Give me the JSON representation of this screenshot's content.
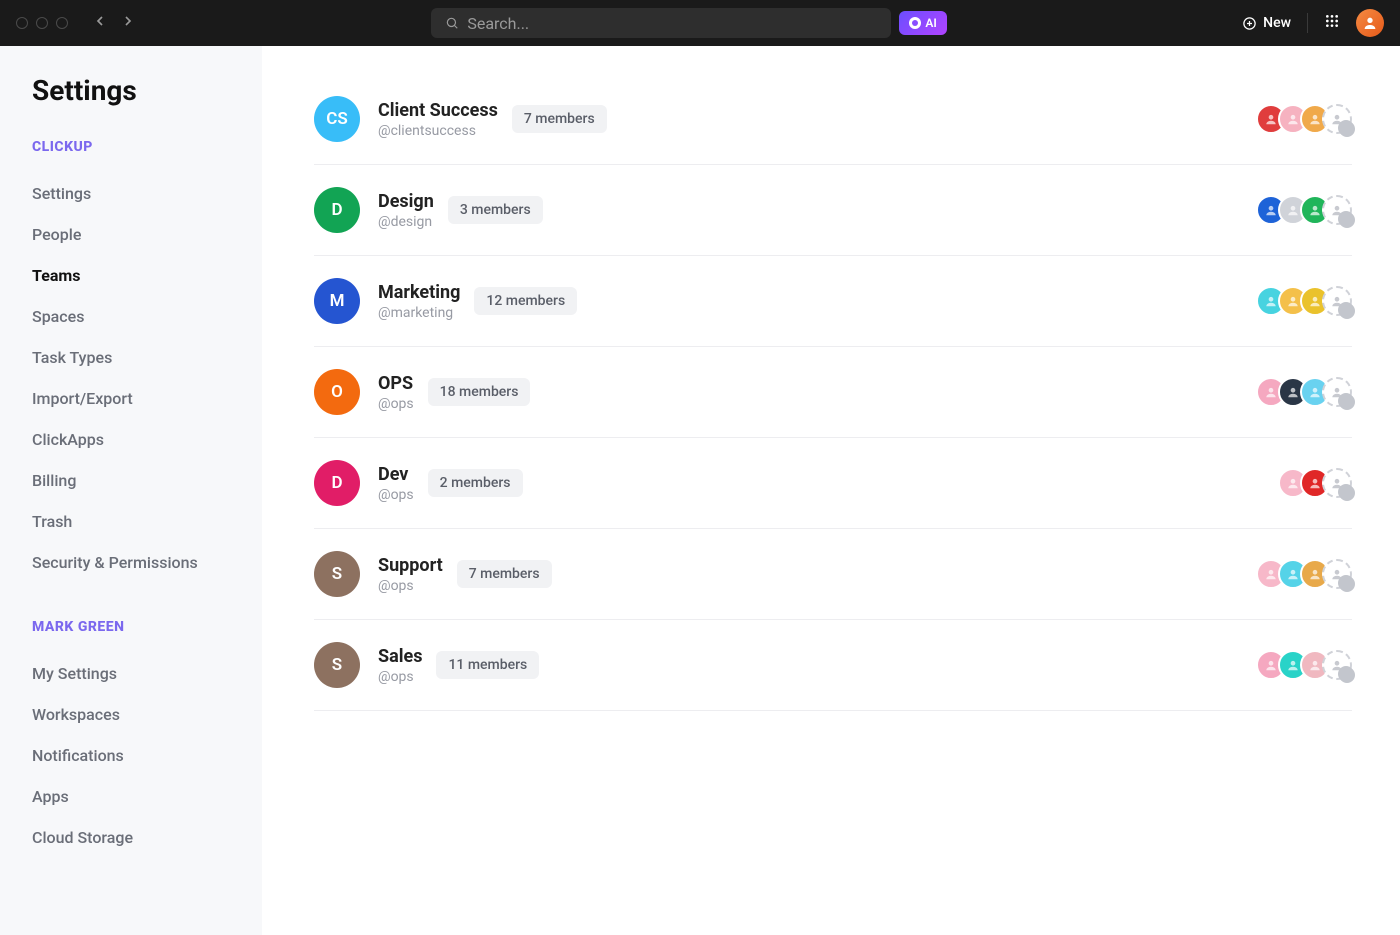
{
  "titlebar": {
    "search_placeholder": "Search...",
    "ai_label": "AI",
    "new_label": "New"
  },
  "sidebar": {
    "title": "Settings",
    "sections": [
      {
        "header": "CLICKUP",
        "items": [
          {
            "label": "Settings",
            "active": false
          },
          {
            "label": "People",
            "active": false
          },
          {
            "label": "Teams",
            "active": true
          },
          {
            "label": "Spaces",
            "active": false
          },
          {
            "label": "Task Types",
            "active": false
          },
          {
            "label": "Import/Export",
            "active": false
          },
          {
            "label": "ClickApps",
            "active": false
          },
          {
            "label": "Billing",
            "active": false
          },
          {
            "label": "Trash",
            "active": false
          },
          {
            "label": "Security & Permissions",
            "active": false
          }
        ]
      },
      {
        "header": "MARK GREEN",
        "items": [
          {
            "label": "My Settings",
            "active": false
          },
          {
            "label": "Workspaces",
            "active": false
          },
          {
            "label": "Notifications",
            "active": false
          },
          {
            "label": "Apps",
            "active": false
          },
          {
            "label": "Cloud Storage",
            "active": false
          }
        ]
      }
    ]
  },
  "teams": [
    {
      "initials": "CS",
      "color": "#38bdf8",
      "name": "Client Success",
      "handle": "@clientsuccess",
      "members_label": "7 members",
      "avatars": [
        "#e03d3d",
        "#f6b2c0",
        "#f0a94a"
      ]
    },
    {
      "initials": "D",
      "color": "#12a454",
      "name": "Design",
      "handle": "@design",
      "members_label": "3 members",
      "avatars": [
        "#1e63d8",
        "#d0d3d9",
        "#20b55a"
      ]
    },
    {
      "initials": "M",
      "color": "#2555d1",
      "name": "Marketing",
      "handle": "@marketing",
      "members_label": "12 members",
      "avatars": [
        "#47d3e0",
        "#f4c04a",
        "#eac22c"
      ]
    },
    {
      "initials": "O",
      "color": "#f36a0f",
      "name": "OPS",
      "handle": "@ops",
      "members_label": "18 members",
      "avatars": [
        "#f5a8c0",
        "#2a3646",
        "#69d2f0"
      ]
    },
    {
      "initials": "D",
      "color": "#e11d67",
      "name": "Dev",
      "handle": "@ops",
      "members_label": "2 members",
      "avatars": [
        "#f7b8c9",
        "#e02727"
      ]
    },
    {
      "initials": "S",
      "color": "#8d7160",
      "name": "Support",
      "handle": "@ops",
      "members_label": "7 members",
      "avatars": [
        "#f7b8c9",
        "#55d3e8",
        "#e8a94a"
      ]
    },
    {
      "initials": "S",
      "color": "#8d7160",
      "name": "Sales",
      "handle": "@ops",
      "members_label": "11 members",
      "avatars": [
        "#f5a8c0",
        "#29d3c8",
        "#f0b8c0"
      ]
    }
  ]
}
